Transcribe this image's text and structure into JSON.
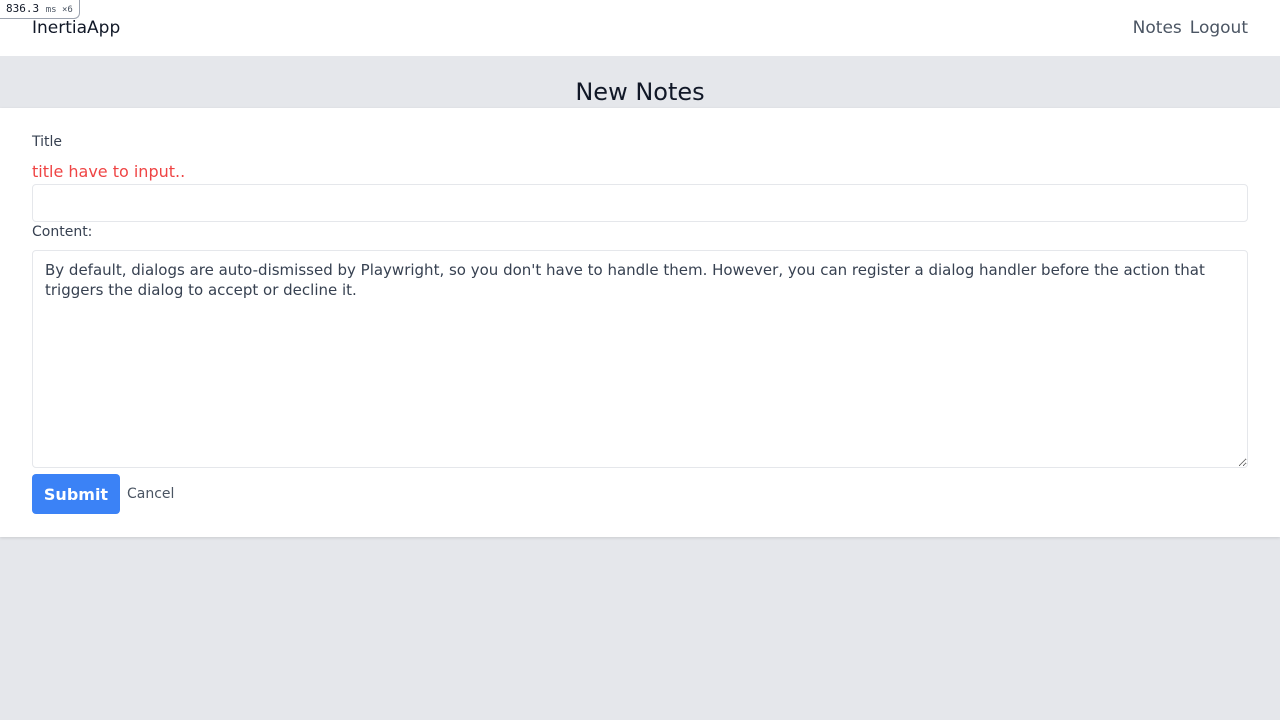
{
  "perf_badge": {
    "value": "836.3",
    "unit": "ms ×6"
  },
  "navbar": {
    "brand": "InertiaApp",
    "links": [
      {
        "label": "Notes"
      },
      {
        "label": "Logout"
      }
    ]
  },
  "page": {
    "title": "New Notes"
  },
  "form": {
    "title_label": "Title",
    "title_error": "title have to input..",
    "title_value": "",
    "content_label": "Content:",
    "content_value": "By default, dialogs are auto-dismissed by Playwright, so you don't have to handle them. However, you can register a dialog handler before the action that triggers the dialog to accept or decline it.",
    "submit_label": "Submit",
    "cancel_label": "Cancel"
  },
  "colors": {
    "accent": "#3b82f6",
    "error": "#ef4444",
    "background": "#e5e7eb"
  }
}
